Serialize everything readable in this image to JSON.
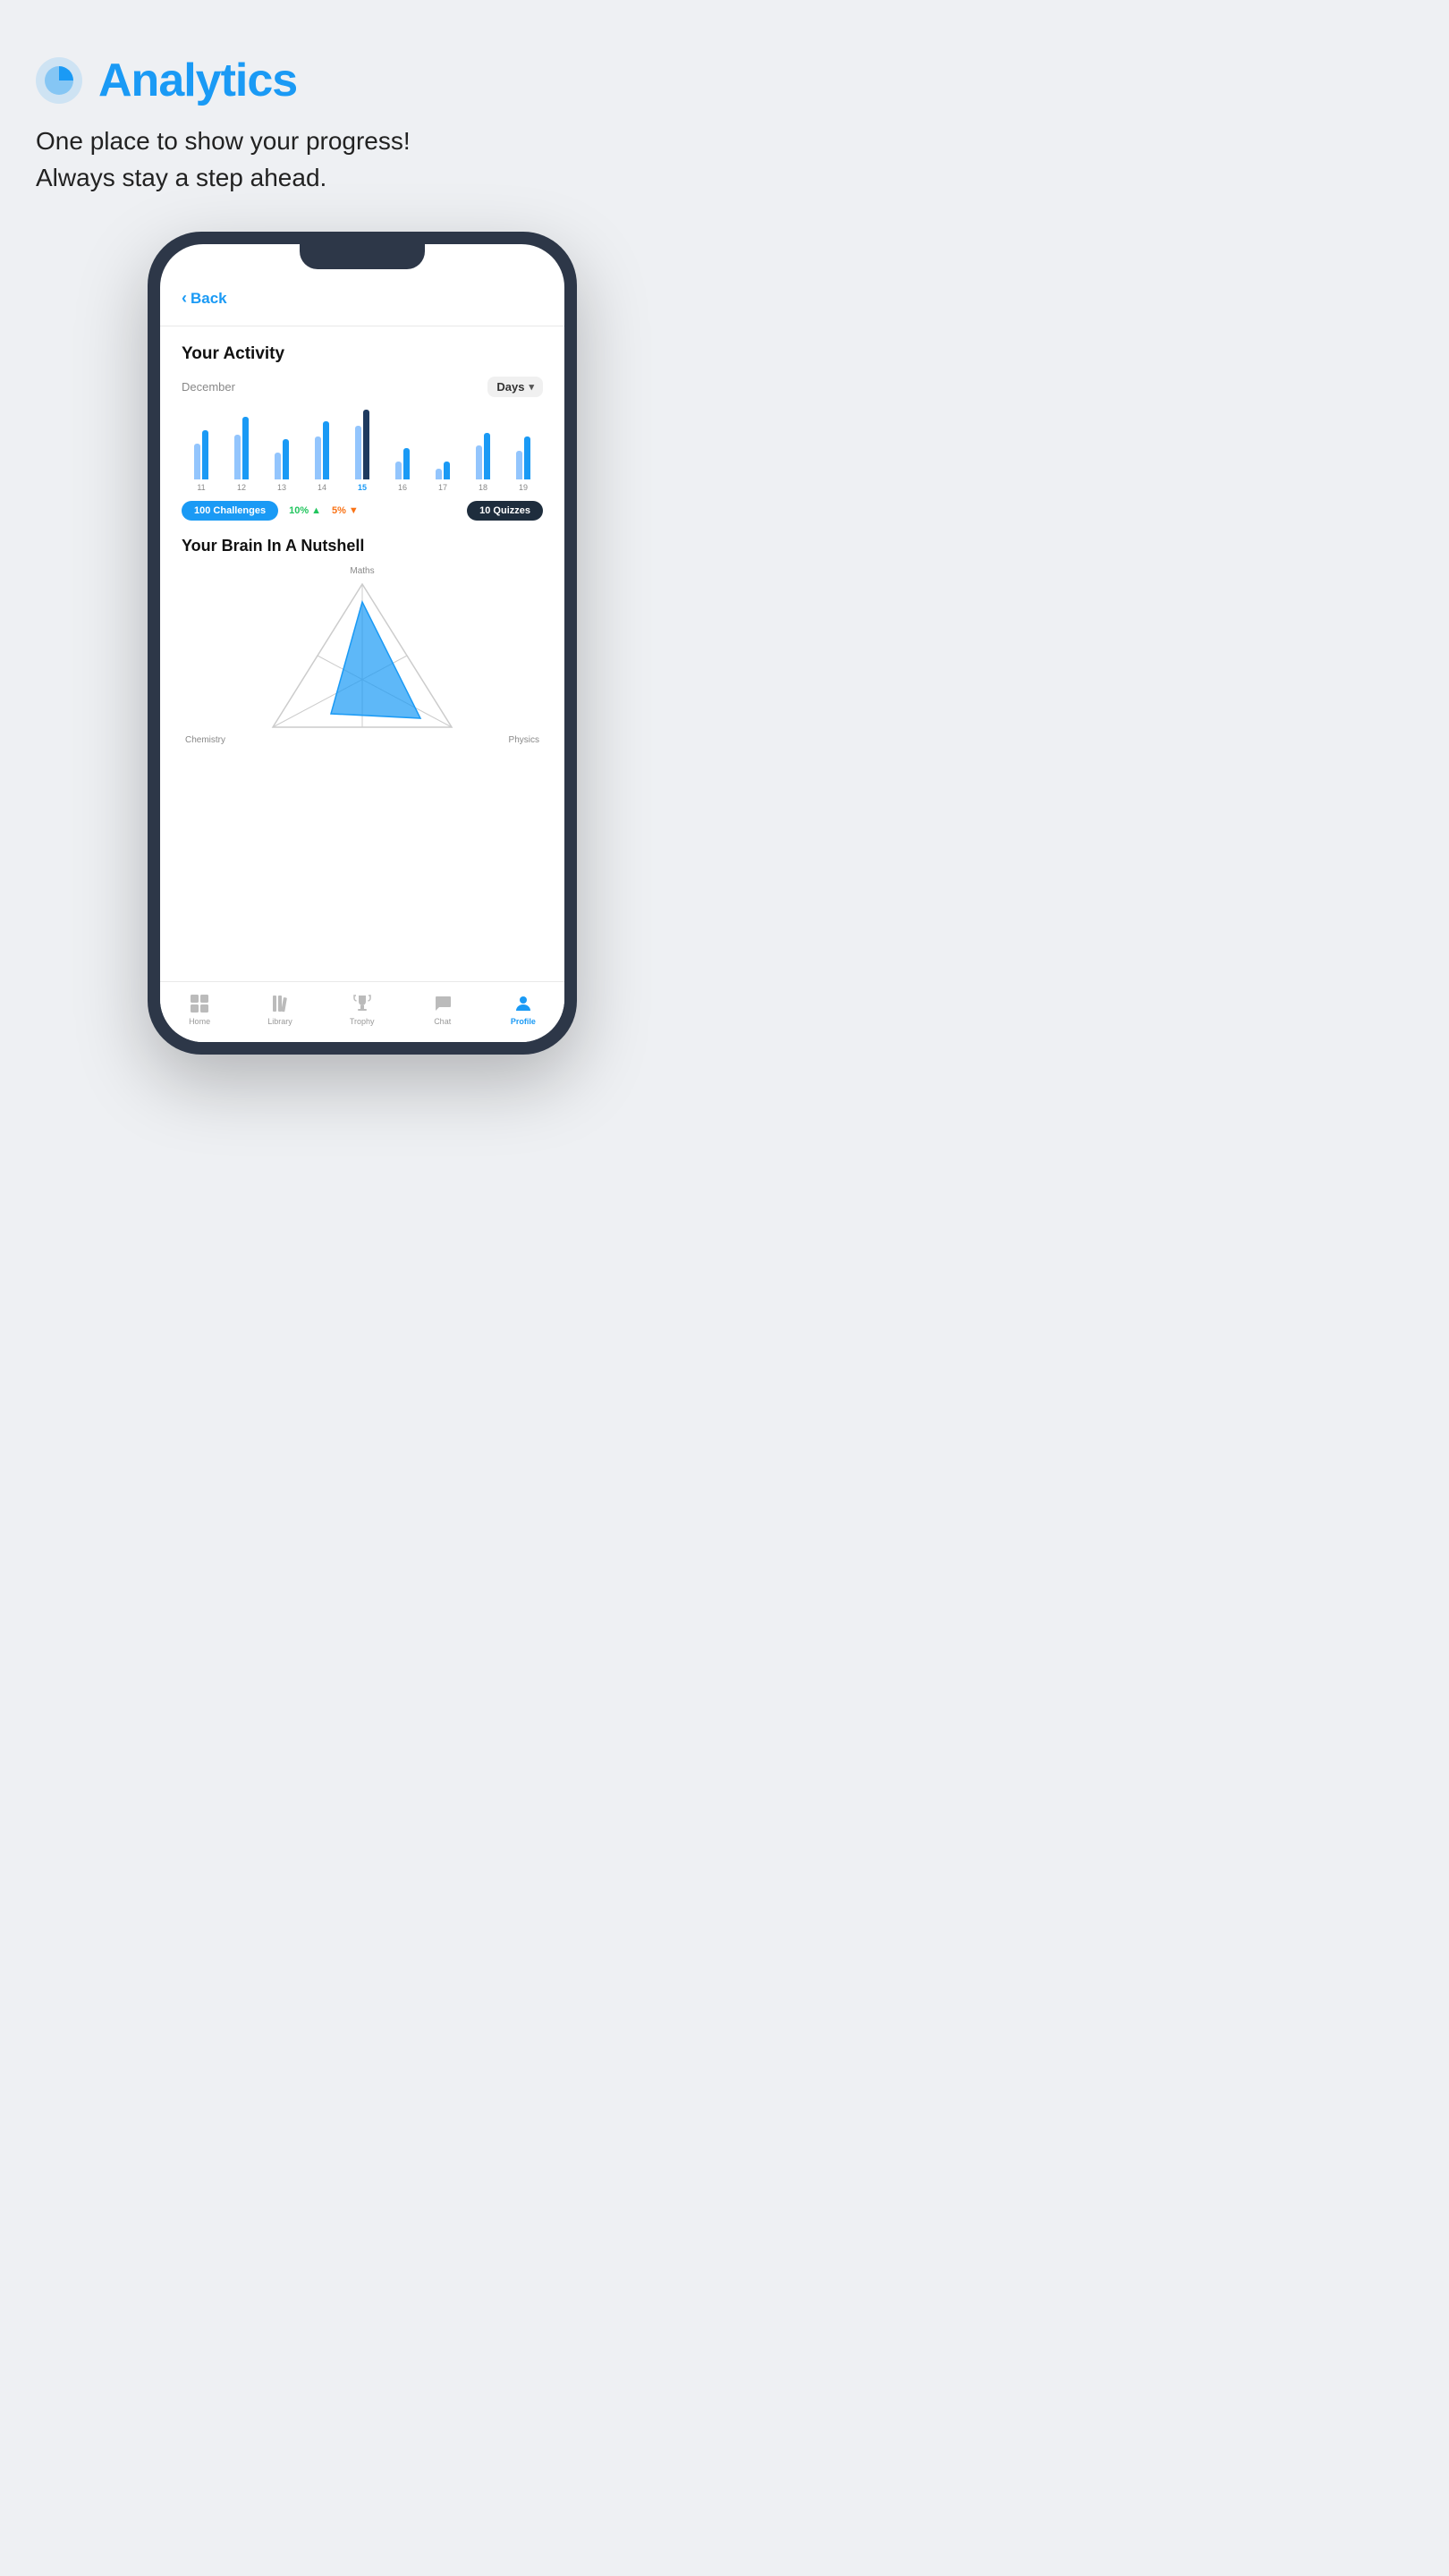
{
  "header": {
    "icon_label": "analytics-pie-icon",
    "title": "Analytics",
    "subtitle_line1": "One place to show your progress!",
    "subtitle_line2": "Always stay a step ahead."
  },
  "phone": {
    "back_button": "Back",
    "activity": {
      "title": "Your Activity",
      "month": "December",
      "period_selector": "Days",
      "bars": [
        {
          "day": "11",
          "heights": [
            40,
            55
          ],
          "active": false
        },
        {
          "day": "12",
          "heights": [
            60,
            70
          ],
          "active": false
        },
        {
          "day": "13",
          "heights": [
            30,
            45
          ],
          "active": false
        },
        {
          "day": "14",
          "heights": [
            50,
            65
          ],
          "active": false
        },
        {
          "day": "15",
          "heights": [
            65,
            78
          ],
          "active": true
        },
        {
          "day": "16",
          "heights": [
            20,
            35
          ],
          "active": false
        },
        {
          "day": "17",
          "heights": [
            10,
            18
          ],
          "active": false
        },
        {
          "day": "18",
          "heights": [
            45,
            52
          ],
          "active": false
        },
        {
          "day": "19",
          "heights": [
            38,
            48
          ],
          "active": false
        }
      ],
      "challenges_badge": "100 Challenges",
      "percent_up": "10%",
      "percent_down": "5%",
      "quizzes_badge": "10 Quizzes"
    },
    "brain": {
      "title": "Your Brain In A Nutshell",
      "labels": {
        "top": "Maths",
        "bottom_left": "Chemistry",
        "bottom_right": "Physics"
      }
    },
    "nav": {
      "items": [
        {
          "label": "Home",
          "icon": "home-icon",
          "active": false
        },
        {
          "label": "Library",
          "icon": "library-icon",
          "active": false
        },
        {
          "label": "Trophy",
          "icon": "trophy-icon",
          "active": false
        },
        {
          "label": "Chat",
          "icon": "chat-icon",
          "active": false
        },
        {
          "label": "Profile",
          "icon": "profile-icon",
          "active": true
        }
      ]
    }
  },
  "colors": {
    "accent": "#1a9af5",
    "dark": "#1e2d3d",
    "background": "#eef0f3",
    "up_color": "#22c55e",
    "down_color": "#f97316"
  }
}
